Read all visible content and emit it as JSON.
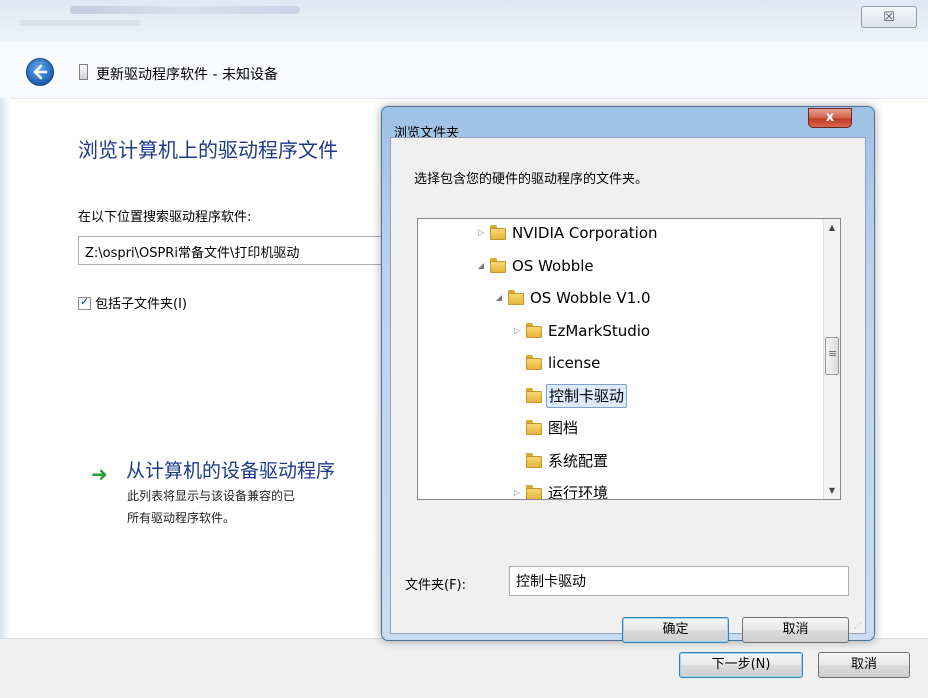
{
  "wizard": {
    "close_glyph": "☒",
    "title": "更新驱动程序软件 - 未知设备",
    "heading": "浏览计算机上的驱动程序文件",
    "search_label": "在以下位置搜索驱动程序软件:",
    "path_value": "Z:\\ospri\\OSPRi常备文件\\打印机驱动",
    "include_subfolders_label": "包括子文件夹(I)",
    "include_subfolders_checked": true,
    "pick_title": "从计算机的设备驱动程序",
    "pick_desc_line1": "此列表将显示与该设备兼容的已",
    "pick_desc_line2": "所有驱动程序软件。",
    "next_label": "下一步(N)",
    "cancel_label": "取消"
  },
  "dialog": {
    "title": "浏览文件夹",
    "close_glyph": "x",
    "prompt": "选择包含您的硬件的驱动程序的文件夹。",
    "tree": [
      {
        "label": "NVIDIA Corporation",
        "expander": "collapsed",
        "level": 0,
        "selected": false
      },
      {
        "label": "OS Wobble",
        "expander": "expanded",
        "level": 0,
        "selected": false
      },
      {
        "label": "OS Wobble V1.0",
        "expander": "expanded",
        "level": 1,
        "selected": false
      },
      {
        "label": "EzMarkStudio",
        "expander": "collapsed",
        "level": 2,
        "selected": false
      },
      {
        "label": "license",
        "expander": "none",
        "level": 2,
        "selected": false
      },
      {
        "label": "控制卡驱动",
        "expander": "none",
        "level": 2,
        "selected": true
      },
      {
        "label": "图档",
        "expander": "none",
        "level": 2,
        "selected": false
      },
      {
        "label": "系统配置",
        "expander": "none",
        "level": 2,
        "selected": false
      },
      {
        "label": "运行环境",
        "expander": "collapsed",
        "level": 2,
        "selected": false
      }
    ],
    "folder_label": "文件夹(F):",
    "folder_value": "控制卡驱动",
    "ok_label": "确定",
    "cancel_label": "取消"
  },
  "colors": {
    "heading_blue": "#1e3a8a",
    "selection_bg": "#dcebfc",
    "dialog_frame": "#b9d3ee",
    "close_red": "#c23a22",
    "green_arrow": "#2e9a3a"
  }
}
